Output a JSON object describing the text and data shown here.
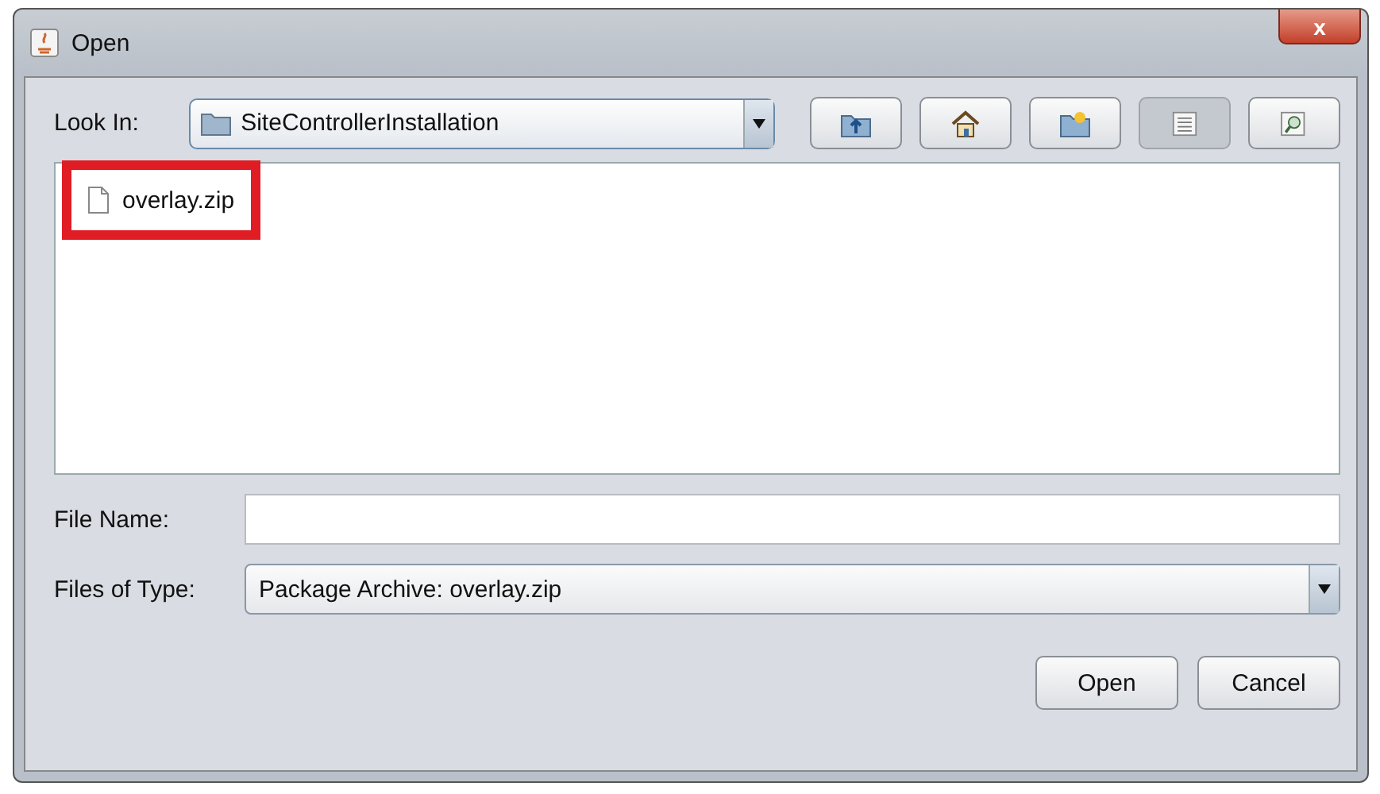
{
  "window": {
    "title": "Open",
    "close_label": "x"
  },
  "look_in": {
    "label": "Look In:",
    "value": "SiteControllerInstallation"
  },
  "toolbar": [
    {
      "kind": "up",
      "selected": false
    },
    {
      "kind": "home",
      "selected": false
    },
    {
      "kind": "new-folder",
      "selected": false
    },
    {
      "kind": "list",
      "selected": true
    },
    {
      "kind": "details",
      "selected": false
    }
  ],
  "files": [
    {
      "name": "overlay.zip",
      "highlighted": true
    }
  ],
  "file_name": {
    "label": "File Name:"
  },
  "file_type": {
    "label": "Files of Type:",
    "value": "Package Archive: overlay.zip"
  },
  "buttons": [
    "Open",
    "Cancel"
  ]
}
